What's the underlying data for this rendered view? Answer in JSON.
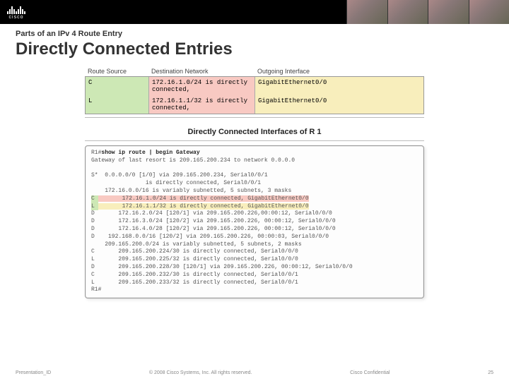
{
  "brand": {
    "name": "cisco"
  },
  "kicker": "Parts of an IPv 4 Route Entry",
  "title": "Directly Connected Entries",
  "columns": {
    "src": "Route Source",
    "dst": "Destination Network",
    "out": "Outgoing Interface"
  },
  "rows": [
    {
      "src": "C",
      "dst": "172.16.1.0/24",
      "conn": " is directly connected, ",
      "out": "GigabitEthernet0/0"
    },
    {
      "src": "L",
      "dst": "172.16.1.1/32",
      "conn": " is directly connected, ",
      "out": "GigabitEthernet0/0"
    }
  ],
  "panel_title": "Directly Connected Interfaces of R 1",
  "terminal": {
    "prompt": "R1#",
    "command": "show ip route | begin Gateway",
    "gateway": "Gateway of last resort is 209.165.200.234 to network 0.0.0.0",
    "lines": [
      "S*  0.0.0.0/0 [1/0] via 209.165.200.234, Serial0/0/1",
      "                is directly connected, Serial0/0/1",
      "    172.16.0.0/16 is variably subnetted, 5 subnets, 3 masks"
    ],
    "hl": [
      {
        "src": "C",
        "rest": "       172.16.1.0/24 is directly connected, GigabitEthernet0/0"
      },
      {
        "src": "L",
        "rest": "       172.16.1.1/32 is directly connected, GigabitEthernet0/0"
      }
    ],
    "lines2": [
      "D       172.16.2.0/24 [120/1] via 209.165.200.226,00:00:12, Serial0/0/0",
      "D       172.16.3.0/24 [120/2] via 209.165.200.226, 00:00:12, Serial0/0/0",
      "D       172.16.4.0/28 [120/2] via 209.165.200.226, 00:00:12, Serial0/0/0",
      "D    192.168.0.0/16 [120/2] via 209.165.200.226, 00:00:03, Serial0/0/0",
      "    209.165.200.0/24 is variably subnetted, 5 subnets, 2 masks",
      "C       209.165.200.224/30 is directly connected, Serial0/0/0",
      "L       209.165.200.225/32 is directly connected, Serial0/0/0",
      "D       209.165.200.228/30 [120/1] via 209.165.200.226, 00:00:12, Serial0/0/0",
      "C       209.165.200.232/30 is directly connected, Serial0/0/1",
      "L       209.165.200.233/32 is directly connected, Serial0/0/1",
      "R1#"
    ]
  },
  "footer": {
    "left": "Presentation_ID",
    "center": "© 2008 Cisco Systems, Inc. All rights reserved.",
    "right": "Cisco Confidential",
    "page": "25"
  }
}
